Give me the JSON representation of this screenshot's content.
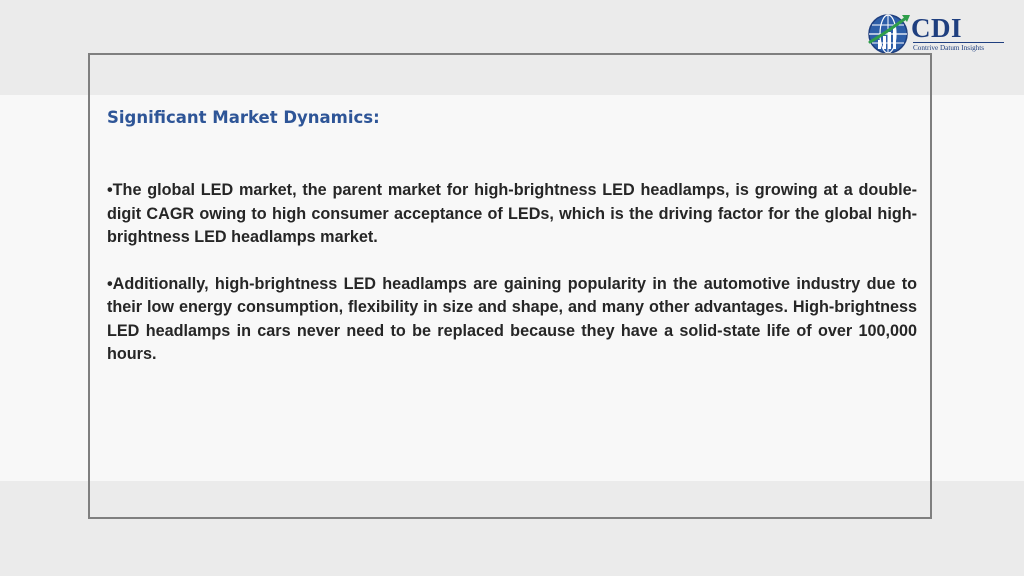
{
  "logo": {
    "name": "CDI",
    "tagline": "Contrive Datum Insights"
  },
  "slide": {
    "heading": "Significant Market Dynamics:",
    "bullets": [
      "•The global LED market, the parent market for high-brightness LED headlamps, is growing at a double-digit CAGR owing to high consumer acceptance of LEDs, which is the driving factor for the global high-brightness LED headlamps market.",
      "•Additionally, high-brightness LED headlamps are gaining popularity in the automotive industry due to their low energy consumption, flexibility in size and shape, and many other advantages. High-brightness LED headlamps in cars never need to be replaced because they have a solid-state life of over 100,000 hours."
    ]
  },
  "colors": {
    "heading": "#2e5597",
    "body_text": "#262626",
    "frame_border": "#7f7f7f",
    "logo_primary": "#1f3f7f",
    "logo_accent": "#2f9e4a"
  }
}
